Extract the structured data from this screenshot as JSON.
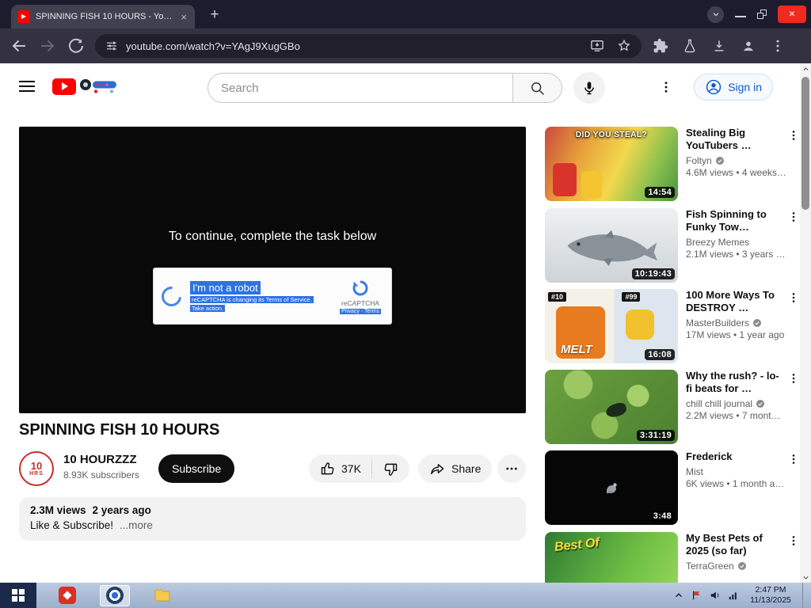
{
  "colors": {
    "youtube_red": "#ff0000",
    "link_blue": "#0b57d0",
    "selection_blue": "#2e72e4",
    "titlebar": "#1d1b2e",
    "close_red": "#ef2a1e",
    "taskbar_blue": "#aebfd8"
  },
  "browser": {
    "tab_title": "SPINNING FISH 10 HOURS - Yo…",
    "url": "youtube.com/watch?v=YAgJ9XugGBo"
  },
  "yt_header": {
    "search_placeholder": "Search",
    "sign_in_label": "Sign in"
  },
  "player": {
    "instruction": "To continue, complete the task below",
    "captcha": {
      "checkbox_label": "I'm not a robot",
      "notice_line1": "reCAPTCHA is changing its Terms of Service.",
      "notice_line2": "Take action.",
      "brand": "reCAPTCHA",
      "links": "Privacy - Terms"
    }
  },
  "video": {
    "title": "SPINNING FISH 10 HOURS",
    "channel_name": "10 HOURZZZ",
    "avatar_line1": "10",
    "avatar_line2": "HRS",
    "subscriber_count": "8.93K subscribers",
    "subscribe_label": "Subscribe",
    "like_count": "37K",
    "share_label": "Share",
    "views": "2.3M views",
    "upload_age": "2 years ago",
    "description_snippet": "Like & Subscribe!",
    "more_label": "...more"
  },
  "suggestions": [
    {
      "title": "Stealing Big YouTubers …",
      "channel": "Foltyn",
      "verified": true,
      "meta": "4.6M views • 4 weeks…",
      "duration": "14:54",
      "thumb_text": "DID YOU STEAL?"
    },
    {
      "title": "Fish Spinning to Funky Tow…",
      "channel": "Breezy Memes",
      "verified": false,
      "meta": "2.1M views • 3 years …",
      "duration": "10:19:43"
    },
    {
      "title": "100 More Ways To DESTROY …",
      "channel": "MasterBuilders",
      "verified": true,
      "meta": "17M views • 1 year ago",
      "duration": "16:08",
      "thumb": {
        "tag1": "#10",
        "tag2": "#99",
        "word": "MELT"
      }
    },
    {
      "title": "Why the rush? - lo-fi beats for …",
      "channel": "chill chill journal",
      "verified": true,
      "meta": "2.2M views • 7 mont…",
      "duration": "3:31:19"
    },
    {
      "title": "Frederick",
      "channel": "Mist",
      "verified": false,
      "meta": "6K views • 1 month a…",
      "duration": "3:48"
    },
    {
      "title": "My Best Pets of 2025 (so far)",
      "channel": "TerraGreen",
      "verified": true,
      "thumb_text": "Best Of"
    }
  ],
  "taskbar": {
    "time": "2:47 PM",
    "date": "11/13/2025"
  }
}
